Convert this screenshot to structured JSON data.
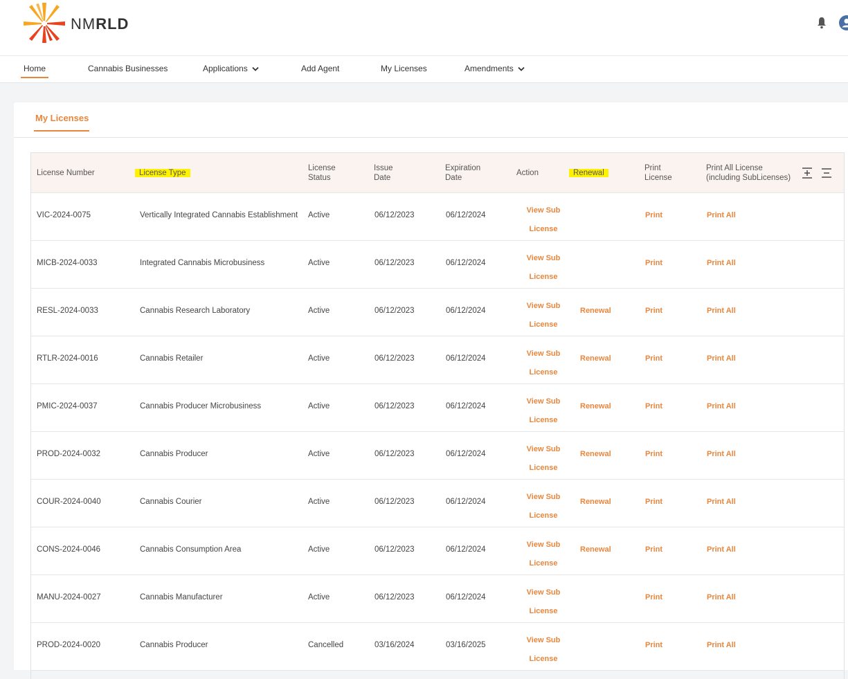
{
  "brand": {
    "pre": "NM",
    "bold": "RLD"
  },
  "nav": {
    "home": "Home",
    "businesses": "Cannabis Businesses",
    "applications": "Applications",
    "add_agent": "Add Agent",
    "my_licenses": "My Licenses",
    "amendments": "Amendments"
  },
  "page": {
    "title": "My Licenses"
  },
  "table": {
    "headers": {
      "number": "License Number",
      "type": "License Type",
      "status_1": "License",
      "status_2": "Status",
      "issue_1": "Issue",
      "issue_2": "Date",
      "exp_1": "Expiration",
      "exp_2": "Date",
      "action": "Action",
      "renewal": "Renewal",
      "print_1": "Print",
      "print_2": "License",
      "printall_1": "Print All License",
      "printall_2": "(including SubLicenses)"
    },
    "links": {
      "view_sub_1": "View Sub",
      "view_sub_2": "License",
      "renewal": "Renewal",
      "print": "Print",
      "print_all": "Print All"
    },
    "rows": [
      {
        "number": "VIC-2024-0075",
        "type": "Vertically Integrated Cannabis Establishment",
        "status": "Active",
        "issue": "06/12/2023",
        "expiration": "06/12/2024",
        "renewal": ""
      },
      {
        "number": "MICB-2024-0033",
        "type": "Integrated Cannabis Microbusiness",
        "status": "Active",
        "issue": "06/12/2023",
        "expiration": "06/12/2024",
        "renewal": ""
      },
      {
        "number": "RESL-2024-0033",
        "type": "Cannabis Research Laboratory",
        "status": "Active",
        "issue": "06/12/2023",
        "expiration": "06/12/2024",
        "renewal": "Renewal"
      },
      {
        "number": "RTLR-2024-0016",
        "type": "Cannabis Retailer",
        "status": "Active",
        "issue": "06/12/2023",
        "expiration": "06/12/2024",
        "renewal": "Renewal"
      },
      {
        "number": "PMIC-2024-0037",
        "type": "Cannabis Producer Microbusiness",
        "status": "Active",
        "issue": "06/12/2023",
        "expiration": "06/12/2024",
        "renewal": "Renewal"
      },
      {
        "number": "PROD-2024-0032",
        "type": "Cannabis Producer",
        "status": "Active",
        "issue": "06/12/2023",
        "expiration": "06/12/2024",
        "renewal": "Renewal"
      },
      {
        "number": "COUR-2024-0040",
        "type": "Cannabis Courier",
        "status": "Active",
        "issue": "06/12/2023",
        "expiration": "06/12/2024",
        "renewal": "Renewal"
      },
      {
        "number": "CONS-2024-0046",
        "type": "Cannabis Consumption Area",
        "status": "Active",
        "issue": "06/12/2023",
        "expiration": "06/12/2024",
        "renewal": "Renewal"
      },
      {
        "number": "MANU-2024-0027",
        "type": "Cannabis Manufacturer",
        "status": "Active",
        "issue": "06/12/2023",
        "expiration": "06/12/2024",
        "renewal": ""
      },
      {
        "number": "PROD-2024-0020",
        "type": "Cannabis Producer",
        "status": "Cancelled",
        "issue": "03/16/2024",
        "expiration": "03/16/2025",
        "renewal": ""
      }
    ]
  },
  "colors": {
    "accent": "#e8863c",
    "highlight": "#fff200",
    "header_bg": "#fbf3ef"
  },
  "icons": [
    "logo-star-icon",
    "bell-icon",
    "user-icon",
    "chevron-down-icon",
    "expand-rows-icon",
    "collapse-rows-icon"
  ]
}
